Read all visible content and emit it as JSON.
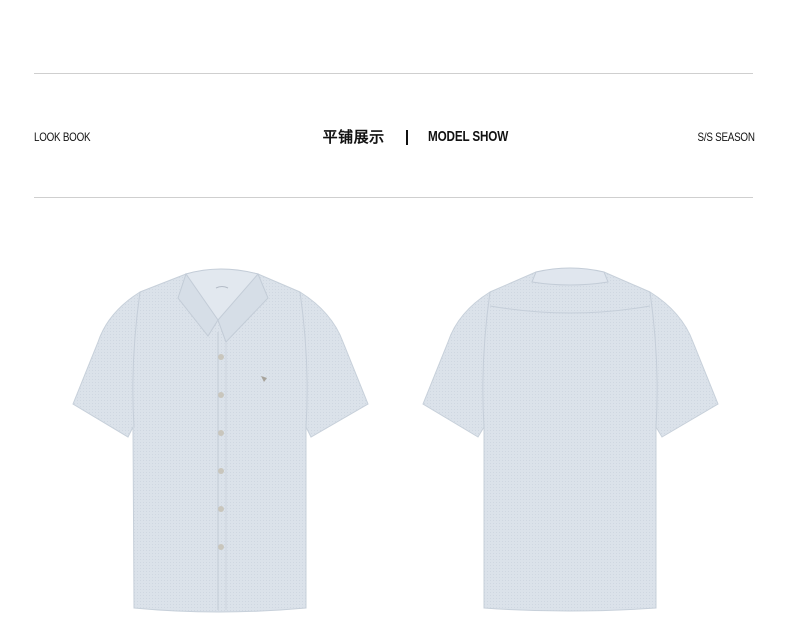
{
  "header": {
    "left_label": "LOOK BOOK",
    "title_cn": "平铺展示",
    "title_en": "MODEL SHOW",
    "right_label": "S/S SEASON"
  },
  "colors": {
    "shirt": "#d9e0e8",
    "shirt_shadow": "#c8d0da",
    "rule": "#cfcfcf",
    "text": "#111111"
  },
  "images": {
    "front": "short-sleeve-shirt-front",
    "back": "short-sleeve-shirt-back"
  }
}
